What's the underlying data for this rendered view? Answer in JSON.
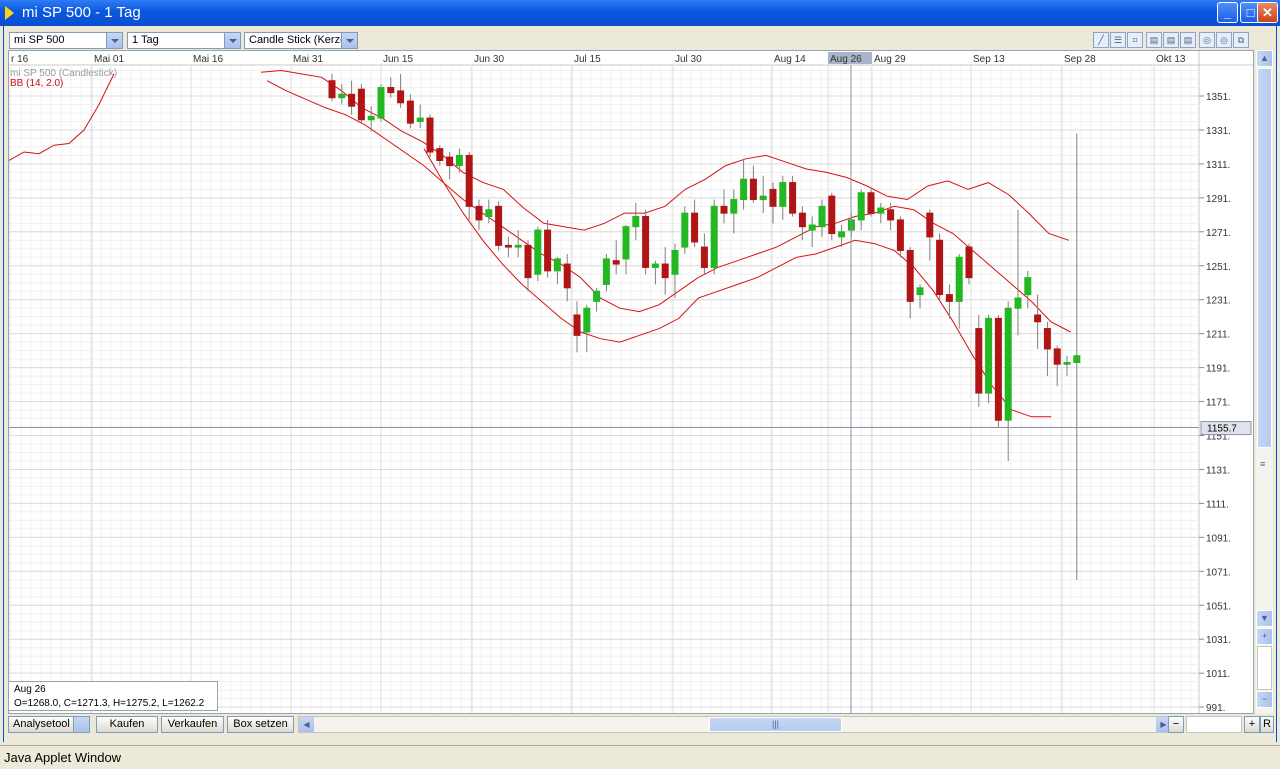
{
  "window": {
    "title": "mi SP 500 - 1 Tag",
    "minimize_glyph": "_",
    "maximize_glyph": "□",
    "close_glyph": "✕"
  },
  "toolbar": {
    "symbol": "mi SP 500",
    "period": "1 Tag",
    "chart_type": "Candle Stick (Kerze"
  },
  "legend": {
    "series": "mi SP 500 (Candlestick)",
    "indicator": "BB (14, 2.0)"
  },
  "crosshair": {
    "date": "Aug 26",
    "price": "1155.7"
  },
  "infobox": {
    "date": "Aug 26",
    "ohlc": "O=1268.0, C=1271.3, H=1275.2, L=1262.2"
  },
  "bottom": {
    "analysetool": "Analysetool",
    "kaufen": "Kaufen",
    "verkaufen": "Verkaufen",
    "box_setzen": "Box setzen",
    "minus": "−",
    "plus": "+",
    "r": "R"
  },
  "statusbar": "Java Applet Window",
  "colors": {
    "up": "#22b822",
    "down": "#b01414",
    "band": "#d81010",
    "grid": "#e4e4e4"
  },
  "chart_data": {
    "type": "candlestick",
    "title": "mi SP 500 - 1 Tag",
    "x_ticks": [
      "r 16",
      "Mai 01",
      "Mai 16",
      "Mai 31",
      "Jun 15",
      "Jun 30",
      "Jul 15",
      "Jul 30",
      "Aug 14",
      "Aug 26",
      "Aug 29",
      "Sep 13",
      "Sep 28",
      "Okt 13"
    ],
    "y_ticks": [
      1351,
      1331,
      1311,
      1291,
      1271,
      1251,
      1231,
      1211,
      1191,
      1171,
      1151,
      1131,
      1111,
      1091,
      1071,
      1051,
      1031,
      1011,
      991
    ],
    "ylim": [
      988,
      1364
    ],
    "candles": [
      {
        "o": 1360,
        "h": 1364,
        "l": 1348,
        "c": 1350
      },
      {
        "o": 1350,
        "h": 1358,
        "l": 1346,
        "c": 1352
      },
      {
        "o": 1352,
        "h": 1360,
        "l": 1340,
        "c": 1345
      },
      {
        "o": 1355,
        "h": 1358,
        "l": 1335,
        "c": 1337
      },
      {
        "o": 1337,
        "h": 1345,
        "l": 1330,
        "c": 1339
      },
      {
        "o": 1338,
        "h": 1358,
        "l": 1336,
        "c": 1356
      },
      {
        "o": 1356,
        "h": 1362,
        "l": 1350,
        "c": 1353
      },
      {
        "o": 1354,
        "h": 1364,
        "l": 1344,
        "c": 1347
      },
      {
        "o": 1348,
        "h": 1352,
        "l": 1332,
        "c": 1335
      },
      {
        "o": 1336,
        "h": 1346,
        "l": 1332,
        "c": 1338
      },
      {
        "o": 1338,
        "h": 1340,
        "l": 1315,
        "c": 1318
      },
      {
        "o": 1320,
        "h": 1322,
        "l": 1310,
        "c": 1313
      },
      {
        "o": 1315,
        "h": 1318,
        "l": 1302,
        "c": 1310
      },
      {
        "o": 1310,
        "h": 1320,
        "l": 1306,
        "c": 1316
      },
      {
        "o": 1316,
        "h": 1318,
        "l": 1278,
        "c": 1286
      },
      {
        "o": 1286,
        "h": 1290,
        "l": 1272,
        "c": 1278
      },
      {
        "o": 1280,
        "h": 1290,
        "l": 1276,
        "c": 1284
      },
      {
        "o": 1286,
        "h": 1289,
        "l": 1260,
        "c": 1263
      },
      {
        "o": 1263,
        "h": 1268,
        "l": 1256,
        "c": 1262
      },
      {
        "o": 1262,
        "h": 1272,
        "l": 1256,
        "c": 1263
      },
      {
        "o": 1263,
        "h": 1266,
        "l": 1236,
        "c": 1244
      },
      {
        "o": 1246,
        "h": 1274,
        "l": 1242,
        "c": 1272
      },
      {
        "o": 1272,
        "h": 1278,
        "l": 1244,
        "c": 1248
      },
      {
        "o": 1248,
        "h": 1256,
        "l": 1240,
        "c": 1255
      },
      {
        "o": 1252,
        "h": 1258,
        "l": 1230,
        "c": 1238
      },
      {
        "o": 1222,
        "h": 1230,
        "l": 1200,
        "c": 1210
      },
      {
        "o": 1212,
        "h": 1228,
        "l": 1200,
        "c": 1226
      },
      {
        "o": 1230,
        "h": 1238,
        "l": 1224,
        "c": 1236
      },
      {
        "o": 1240,
        "h": 1258,
        "l": 1236,
        "c": 1255
      },
      {
        "o": 1254,
        "h": 1266,
        "l": 1246,
        "c": 1252
      },
      {
        "o": 1255,
        "h": 1275,
        "l": 1246,
        "c": 1274
      },
      {
        "o": 1274,
        "h": 1288,
        "l": 1266,
        "c": 1280
      },
      {
        "o": 1280,
        "h": 1284,
        "l": 1246,
        "c": 1250
      },
      {
        "o": 1250,
        "h": 1254,
        "l": 1240,
        "c": 1252
      },
      {
        "o": 1252,
        "h": 1262,
        "l": 1234,
        "c": 1244
      },
      {
        "o": 1246,
        "h": 1264,
        "l": 1232,
        "c": 1260
      },
      {
        "o": 1262,
        "h": 1286,
        "l": 1258,
        "c": 1282
      },
      {
        "o": 1282,
        "h": 1290,
        "l": 1262,
        "c": 1265
      },
      {
        "o": 1262,
        "h": 1270,
        "l": 1246,
        "c": 1250
      },
      {
        "o": 1250,
        "h": 1290,
        "l": 1246,
        "c": 1286
      },
      {
        "o": 1286,
        "h": 1296,
        "l": 1276,
        "c": 1282
      },
      {
        "o": 1282,
        "h": 1296,
        "l": 1270,
        "c": 1290
      },
      {
        "o": 1290,
        "h": 1314,
        "l": 1284,
        "c": 1302
      },
      {
        "o": 1302,
        "h": 1310,
        "l": 1288,
        "c": 1290
      },
      {
        "o": 1290,
        "h": 1304,
        "l": 1282,
        "c": 1292
      },
      {
        "o": 1296,
        "h": 1300,
        "l": 1276,
        "c": 1286
      },
      {
        "o": 1286,
        "h": 1304,
        "l": 1278,
        "c": 1300
      },
      {
        "o": 1300,
        "h": 1304,
        "l": 1280,
        "c": 1282
      },
      {
        "o": 1282,
        "h": 1286,
        "l": 1266,
        "c": 1274
      },
      {
        "o": 1272,
        "h": 1280,
        "l": 1262,
        "c": 1275
      },
      {
        "o": 1274,
        "h": 1290,
        "l": 1268,
        "c": 1286
      },
      {
        "o": 1292,
        "h": 1294,
        "l": 1266,
        "c": 1270
      },
      {
        "o": 1268,
        "h": 1275,
        "l": 1262,
        "c": 1271
      },
      {
        "o": 1272,
        "h": 1282,
        "l": 1268,
        "c": 1278
      },
      {
        "o": 1278,
        "h": 1296,
        "l": 1272,
        "c": 1294
      },
      {
        "o": 1294,
        "h": 1296,
        "l": 1280,
        "c": 1282
      },
      {
        "o": 1282,
        "h": 1288,
        "l": 1276,
        "c": 1285
      },
      {
        "o": 1284,
        "h": 1288,
        "l": 1272,
        "c": 1278
      },
      {
        "o": 1278,
        "h": 1280,
        "l": 1256,
        "c": 1260
      },
      {
        "o": 1260,
        "h": 1262,
        "l": 1220,
        "c": 1230
      },
      {
        "o": 1234,
        "h": 1240,
        "l": 1226,
        "c": 1238
      },
      {
        "o": 1282,
        "h": 1284,
        "l": 1254,
        "c": 1268
      },
      {
        "o": 1266,
        "h": 1270,
        "l": 1230,
        "c": 1234
      },
      {
        "o": 1234,
        "h": 1240,
        "l": 1220,
        "c": 1230
      },
      {
        "o": 1230,
        "h": 1258,
        "l": 1214,
        "c": 1256
      },
      {
        "o": 1262,
        "h": 1264,
        "l": 1240,
        "c": 1244
      },
      {
        "o": 1214,
        "h": 1222,
        "l": 1168,
        "c": 1176
      },
      {
        "o": 1176,
        "h": 1222,
        "l": 1170,
        "c": 1220
      },
      {
        "o": 1220,
        "h": 1222,
        "l": 1156,
        "c": 1160
      },
      {
        "o": 1160,
        "h": 1230,
        "l": 1136,
        "c": 1226
      },
      {
        "o": 1226,
        "h": 1284,
        "l": 1210,
        "c": 1232
      },
      {
        "o": 1234,
        "h": 1248,
        "l": 1226,
        "c": 1244
      },
      {
        "o": 1222,
        "h": 1234,
        "l": 1202,
        "c": 1218
      },
      {
        "o": 1214,
        "h": 1218,
        "l": 1186,
        "c": 1202
      },
      {
        "o": 1202,
        "h": 1204,
        "l": 1180,
        "c": 1193
      },
      {
        "o": 1193,
        "h": 1198,
        "l": 1186,
        "c": 1194
      },
      {
        "o": 1194,
        "h": 1329,
        "l": 1066,
        "c": 1198
      }
    ],
    "bollinger": {
      "label": "BB (14, 2.0)",
      "upper_early": [
        1313,
        1318,
        1317,
        1322,
        1323,
        1331,
        1346,
        1364
      ],
      "upper": [
        1365,
        1366,
        1364,
        1362,
        1354,
        1344,
        1338,
        1330,
        1324,
        1316,
        1306,
        1300,
        1296,
        1285,
        1276,
        1274,
        1272,
        1276,
        1282,
        1282,
        1286,
        1296,
        1302,
        1310,
        1314,
        1316,
        1312,
        1308,
        1306,
        1303,
        1298,
        1292,
        1290,
        1298,
        1301,
        1296,
        1300,
        1293,
        1282,
        1270,
        1266
      ],
      "middle": [
        1360,
        1354,
        1349,
        1344,
        1340,
        1334,
        1326,
        1318,
        1310,
        1300,
        1290,
        1282,
        1274,
        1266,
        1258,
        1252,
        1244,
        1232,
        1226,
        1224,
        1228,
        1236,
        1244,
        1250,
        1254,
        1258,
        1262,
        1268,
        1274,
        1276,
        1280,
        1282,
        1286,
        1284,
        1276,
        1270,
        1260,
        1250,
        1240,
        1230,
        1218,
        1212
      ],
      "lower": [
        1320,
        1300,
        1282,
        1266,
        1252,
        1240,
        1230,
        1220,
        1212,
        1208,
        1206,
        1210,
        1214,
        1220,
        1232,
        1236,
        1240,
        1244,
        1250,
        1256,
        1258,
        1262,
        1266,
        1264,
        1260,
        1250,
        1236,
        1218,
        1198,
        1180,
        1166,
        1162,
        1162
      ]
    }
  }
}
